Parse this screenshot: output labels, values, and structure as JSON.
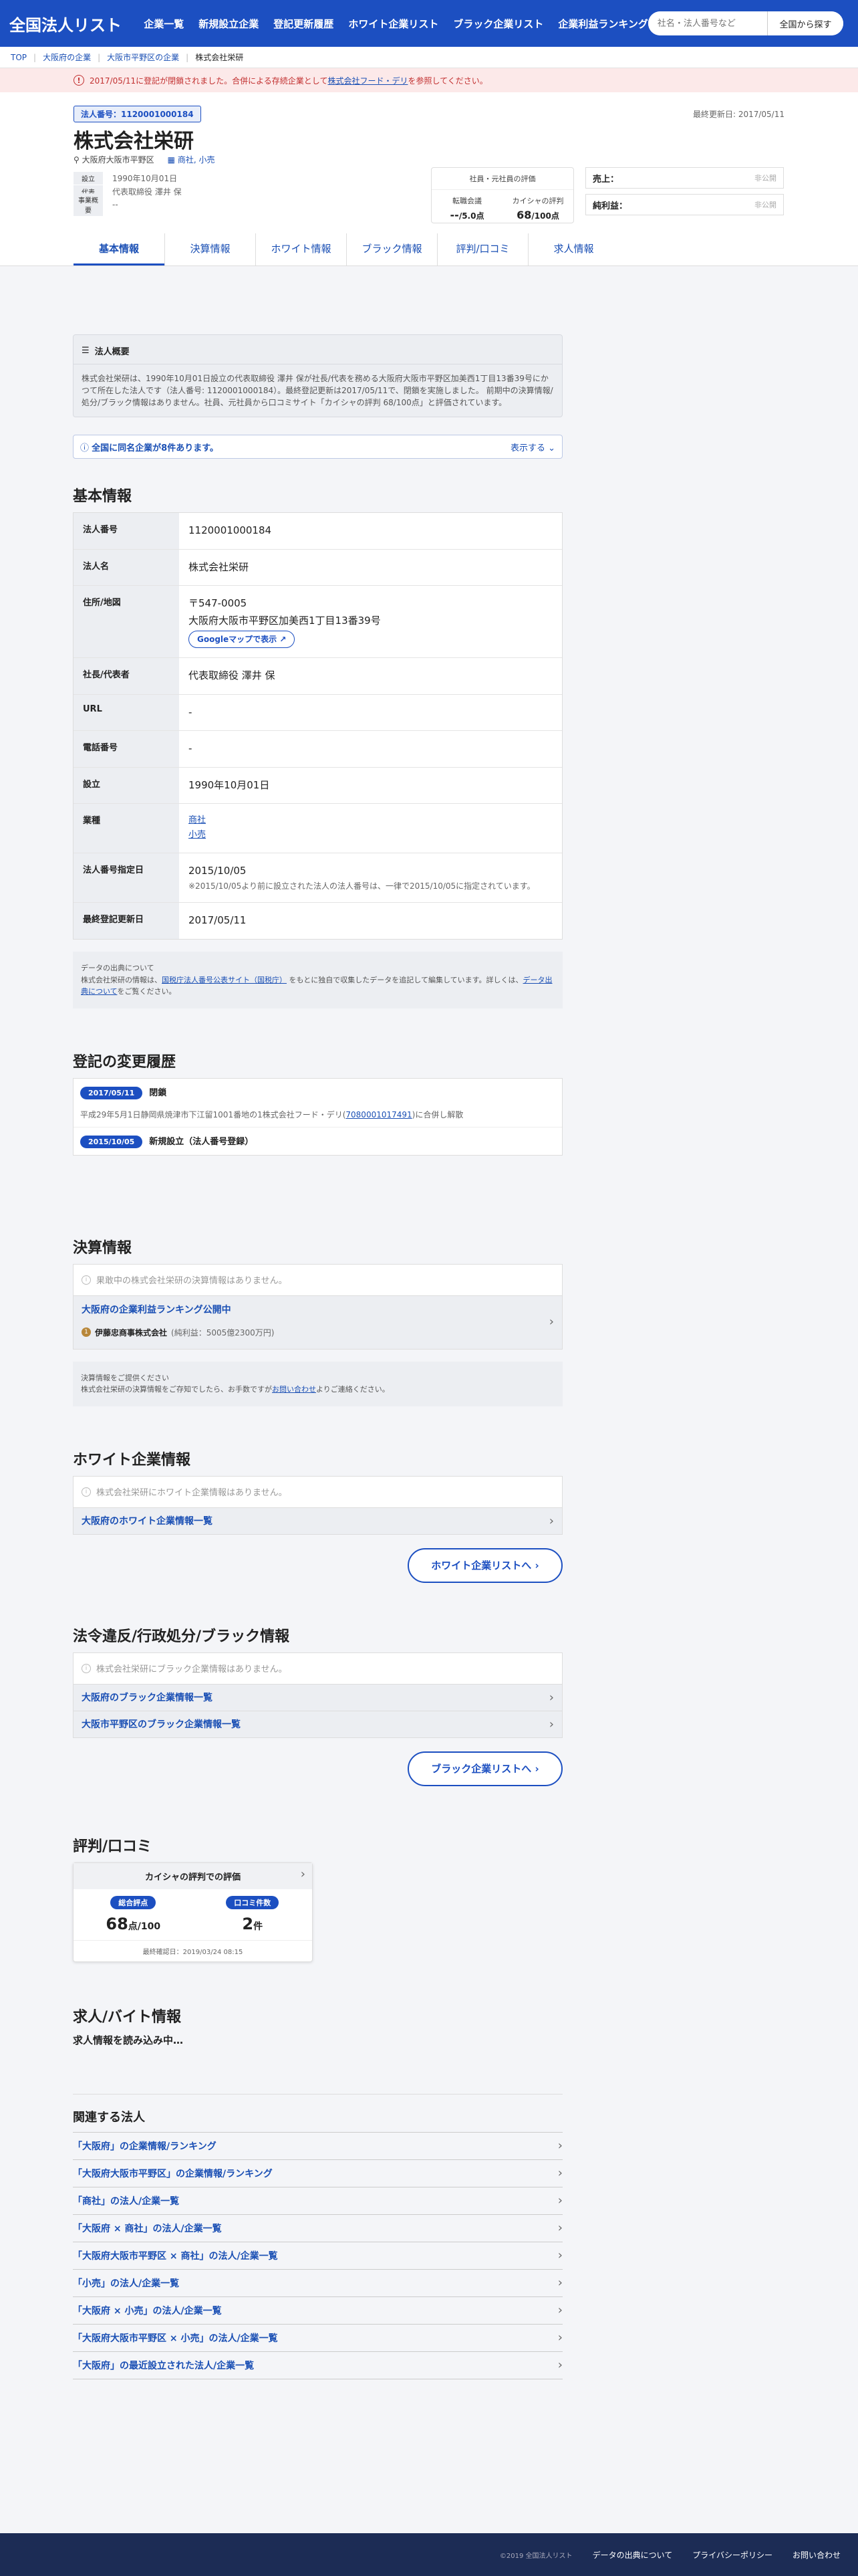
{
  "header": {
    "logo": "全国法人リスト",
    "nav": [
      "企業一覧",
      "新規設立企業",
      "登記更新履歴",
      "ホワイト企業リスト",
      "ブラック企業リスト",
      "企業利益ランキング"
    ],
    "search_placeholder": "社名・法人番号など",
    "search_button": "全国から探す"
  },
  "breadcrumb": [
    "TOP",
    "大阪府の企業",
    "大阪市平野区の企業",
    "株式会社栄研"
  ],
  "alert": {
    "prefix": "2017/05/11に登記が閉鎖されました。合併による存続企業として",
    "link": "株式会社フード・デリ",
    "suffix": "を参照してください。"
  },
  "company": {
    "number_badge": "法人番号：1120001000184",
    "name": "株式会社栄研",
    "updated": "最終更新日: 2017/05/11",
    "location": "大阪府大阪市平野区",
    "industry": "商社, 小売",
    "facts": [
      {
        "k": "設立",
        "v": "1990年10月01日"
      },
      {
        "k": "代表",
        "v": "代表取締役 澤井 保"
      },
      {
        "k": "事業概要",
        "v": "--"
      }
    ]
  },
  "evaluation": {
    "title": "社員・元社員の評価",
    "a_label": "転職会議",
    "a_value": "--",
    "a_unit": "/5.0点",
    "b_label": "カイシャの評判",
    "b_value": "68",
    "b_unit": "/100点"
  },
  "money": [
    {
      "k": "売上：",
      "v": "非公開"
    },
    {
      "k": "純利益：",
      "v": "非公開"
    }
  ],
  "tabs": [
    "基本情報",
    "決算情報",
    "ホワイト情報",
    "ブラック情報",
    "評判/口コミ",
    "求人情報"
  ],
  "summary": {
    "title": "法人概要",
    "body": "株式会社栄研は、1990年10月01日設立の代表取締役 澤井 保が社長/代表を務める大阪府大阪市平野区加美西1丁目13番39号にかつて所在した法人です（法人番号: 1120001000184）。最終登記更新は2017/05/11で、閉鎖を実施しました。 前期中の決算情報/処分/ブラック情報はありません。社員、元社員から口コミサイト「カイシャの評判 68/100点」と評価されています。"
  },
  "same_name": {
    "text": "全国に同名企業が8件あります。",
    "toggle": "表示する"
  },
  "basic": {
    "heading": "基本情報",
    "rows": [
      {
        "k": "法人番号",
        "v": "1120001000184"
      },
      {
        "k": "法人名",
        "v": "株式会社栄研"
      },
      {
        "k": "住所/地図",
        "zip": "〒547-0005",
        "addr": "大阪府大阪市平野区加美西1丁目13番39号",
        "map": "Googleマップで表示"
      },
      {
        "k": "社長/代表者",
        "v": "代表取締役 澤井 保"
      },
      {
        "k": "URL",
        "v": "-"
      },
      {
        "k": "電話番号",
        "v": "-"
      },
      {
        "k": "設立",
        "v": "1990年10月01日"
      },
      {
        "k": "業種",
        "v1": "商社",
        "v2": "小売"
      },
      {
        "k": "法人番号指定日",
        "v": "2015/10/05",
        "sub": "※2015/10/05より前に設立された法人の法人番号は、一律で2015/10/05に指定されています。"
      },
      {
        "k": "最終登記更新日",
        "v": "2017/05/11"
      }
    ],
    "source_title": "データの出典について",
    "source_a": "株式会社栄研の情報は、",
    "source_link1": "国税庁法人番号公表サイト（国税庁）",
    "source_b": "をもとに独自で収集したデータを追記して編集しています。詳しくは、",
    "source_link2": "データ出典について",
    "source_c": "をご覧ください。"
  },
  "history": {
    "heading": "登記の変更履歴",
    "items": [
      {
        "date": "2017/05/11",
        "event": "閉鎖",
        "detail_a": "平成29年5月1日静岡県焼津市下江留1001番地の1株式会社フード・デリ(",
        "detail_link": "7080001017491",
        "detail_b": ")に合併し解散"
      },
      {
        "date": "2015/10/05",
        "event": "新規設立（法人番号登録）"
      }
    ]
  },
  "finance": {
    "heading": "決算情報",
    "empty": "果敢中の株式会社栄研の決算情報はありません。",
    "rank_title": "大阪府の企業利益ランキング公開中",
    "rank_sub": "伊藤忠商事株式会社",
    "rank_sub2": "(純利益：5005億2300万円)",
    "note_title": "決算情報をご提供ください",
    "note_a": "株式会社栄研の決算情報をご存知でしたら、お手数ですが",
    "note_link": "お問い合わせ",
    "note_b": "よりご連絡ください。"
  },
  "white": {
    "heading": "ホワイト企業情報",
    "empty": "株式会社栄研にホワイト企業情報はありません。",
    "links": [
      "大阪府のホワイト企業情報一覧"
    ],
    "button": "ホワイト企業リストへ"
  },
  "black": {
    "heading": "法令違反/行政処分/ブラック情報",
    "empty": "株式会社栄研にブラック企業情報はありません。",
    "links": [
      "大阪府のブラック企業情報一覧",
      "大阪市平野区のブラック企業情報一覧"
    ],
    "button": "ブラック企業リストへ"
  },
  "review": {
    "heading": "評判/口コミ",
    "title": "カイシャの評判での評価",
    "score_label": "総合評点",
    "score": "68",
    "score_unit": "点/100",
    "count_label": "口コミ件数",
    "count": "2",
    "count_unit": "件",
    "date": "最終確認日：2019/03/24 08:15"
  },
  "jobs": {
    "heading": "求人/バイト情報",
    "loading": "求人情報を読み込み中…"
  },
  "related": {
    "heading": "関連する法人",
    "items": [
      "「大阪府」の企業情報/ランキング",
      "「大阪府大阪市平野区」の企業情報/ランキング",
      "「商社」の法人/企業一覧",
      "「大阪府 × 商社」の法人/企業一覧",
      "「大阪府大阪市平野区 × 商社」の法人/企業一覧",
      "「小売」の法人/企業一覧",
      "「大阪府 × 小売」の法人/企業一覧",
      "「大阪府大阪市平野区 × 小売」の法人/企業一覧",
      "「大阪府」の最近設立された法人/企業一覧"
    ]
  },
  "footer": {
    "copy": "©2019 全国法人リスト",
    "links": [
      "データの出典について",
      "プライバシーポリシー",
      "お問い合わせ"
    ]
  }
}
